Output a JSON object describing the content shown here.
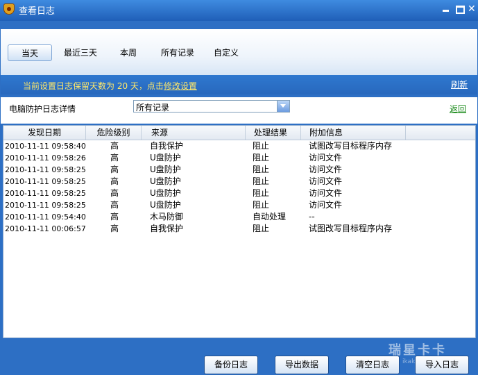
{
  "window": {
    "title": "查看日志",
    "close_glyph": "✕"
  },
  "tabs": [
    {
      "label": "当天",
      "active": true
    },
    {
      "label": "最近三天",
      "active": false
    },
    {
      "label": "本周",
      "active": false
    },
    {
      "label": "所有记录",
      "active": false
    },
    {
      "label": "自定义",
      "active": false
    }
  ],
  "info": {
    "text": "当前设置日志保留天数为 20 天，点击",
    "link": "修改设置",
    "refresh": "刷新",
    "accent_color": "#ffe86a"
  },
  "filter": {
    "label": "电脑防护日志详情",
    "selected": "所有记录",
    "back": "返回"
  },
  "table": {
    "headers": [
      "发现日期",
      "危险级别",
      "来源",
      "处理结果",
      "附加信息"
    ],
    "rows": [
      [
        "2010-11-11 09:58:40",
        "高",
        "自我保护",
        "阻止",
        "试图改写目标程序内存"
      ],
      [
        "2010-11-11 09:58:26",
        "高",
        "U盘防护",
        "阻止",
        "访问文件"
      ],
      [
        "2010-11-11 09:58:25",
        "高",
        "U盘防护",
        "阻止",
        "访问文件"
      ],
      [
        "2010-11-11 09:58:25",
        "高",
        "U盘防护",
        "阻止",
        "访问文件"
      ],
      [
        "2010-11-11 09:58:25",
        "高",
        "U盘防护",
        "阻止",
        "访问文件"
      ],
      [
        "2010-11-11 09:58:25",
        "高",
        "U盘防护",
        "阻止",
        "访问文件"
      ],
      [
        "2010-11-11 09:54:40",
        "高",
        "木马防御",
        "自动处理",
        "--"
      ],
      [
        "2010-11-11 00:06:57",
        "高",
        "自我保护",
        "阻止",
        "试图改写目标程序内存"
      ]
    ]
  },
  "buttons": {
    "backup": "备份日志",
    "export": "导出数据",
    "clear": "清空日志",
    "import": "导入日志"
  },
  "watermark": {
    "text": "瑞星卡卡",
    "sub": "ikaka.com"
  }
}
